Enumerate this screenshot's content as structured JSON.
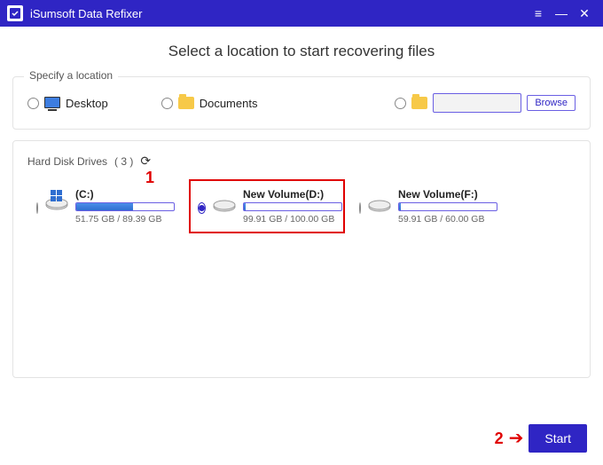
{
  "app": {
    "name": "iSumsoft Data Refixer"
  },
  "headline": "Select a location to start recovering files",
  "specify": {
    "title": "Specify a location",
    "options": {
      "desktop": "Desktop",
      "documents": "Documents",
      "browse": "Browse"
    }
  },
  "drives": {
    "title_prefix": "Hard Disk Drives",
    "count": "( 3 )",
    "items": [
      {
        "name": "(C:)",
        "used": 51.75,
        "total": 89.39,
        "label": "51.75 GB / 89.39 GB",
        "fill_pct": 58,
        "selected": false,
        "os": true
      },
      {
        "name": "New Volume(D:)",
        "used": 99.91,
        "total": 100.0,
        "label": "99.91 GB / 100.00 GB",
        "fill_pct": 2,
        "selected": true,
        "os": false
      },
      {
        "name": "New Volume(F:)",
        "used": 59.91,
        "total": 60.0,
        "label": "59.91 GB / 60.00 GB",
        "fill_pct": 2,
        "selected": false,
        "os": false
      }
    ]
  },
  "annotations": {
    "step1": "1",
    "step2": "2"
  },
  "buttons": {
    "start": "Start"
  }
}
